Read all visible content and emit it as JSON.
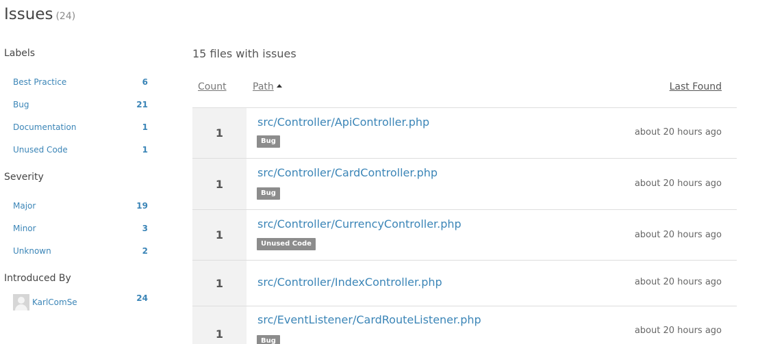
{
  "header": {
    "title": "Issues",
    "count": "(24)"
  },
  "sidebar": {
    "labels": {
      "heading": "Labels",
      "items": [
        {
          "label": "Best Practice",
          "count": "6"
        },
        {
          "label": "Bug",
          "count": "21"
        },
        {
          "label": "Documentation",
          "count": "1"
        },
        {
          "label": "Unused Code",
          "count": "1"
        }
      ]
    },
    "severity": {
      "heading": "Severity",
      "items": [
        {
          "label": "Major",
          "count": "19"
        },
        {
          "label": "Minor",
          "count": "3"
        },
        {
          "label": "Unknown",
          "count": "2"
        }
      ]
    },
    "introduced_by": {
      "heading": "Introduced By",
      "user": {
        "name": "KarlComSe",
        "count": "24"
      }
    }
  },
  "main": {
    "heading": "15 files with issues",
    "columns": {
      "count": "Count",
      "path": "Path",
      "last_found": "Last Found"
    },
    "rows": [
      {
        "count": "1",
        "path": "src/Controller/ApiController.php",
        "tag": "Bug",
        "last_found": "about 20 hours ago"
      },
      {
        "count": "1",
        "path": "src/Controller/CardController.php",
        "tag": "Bug",
        "last_found": "about 20 hours ago"
      },
      {
        "count": "1",
        "path": "src/Controller/CurrencyController.php",
        "tag": "Unused Code",
        "last_found": "about 20 hours ago"
      },
      {
        "count": "1",
        "path": "src/Controller/IndexController.php",
        "tag": "",
        "last_found": "about 20 hours ago"
      },
      {
        "count": "1",
        "path": "src/EventListener/CardRouteListener.php",
        "tag": "Bug",
        "last_found": "about 20 hours ago"
      }
    ]
  },
  "icons": {
    "sort": "sort-ascending-icon",
    "avatar": "user-avatar-icon"
  },
  "colors": {
    "link": "#3b85b7",
    "tag_bg": "#8c8c8c",
    "count_cell_bg": "#f2f2f2",
    "divider": "#dddddd"
  }
}
